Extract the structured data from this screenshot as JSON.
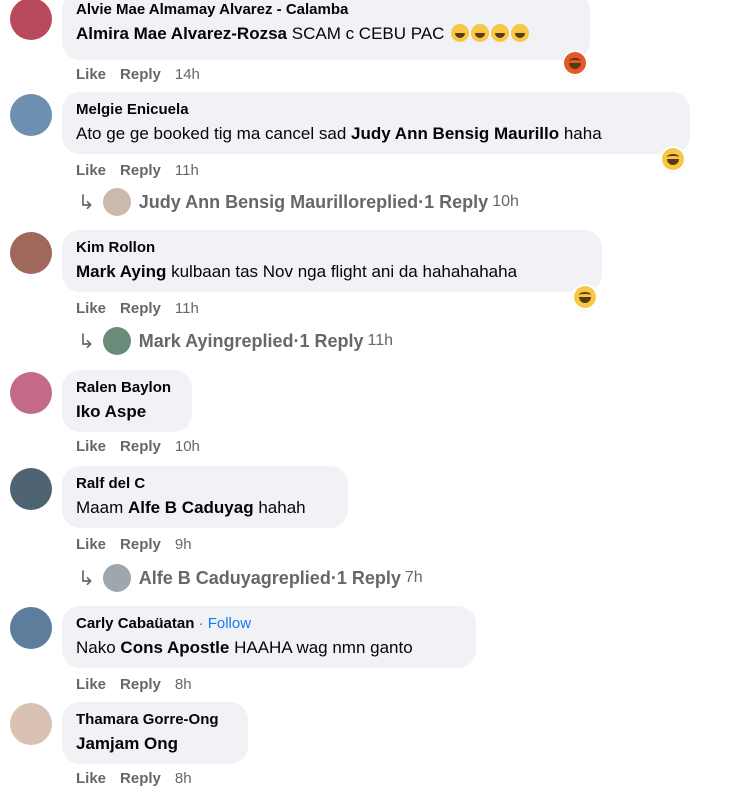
{
  "comments": [
    {
      "author": "Alvie Mae Almamay Alvarez - Calamba",
      "mention": "Almira Mae Alvarez-Rozsa",
      "text": " SCAM c CEBU PAC",
      "like": "Like",
      "reply": "Reply",
      "time": "14h",
      "avatar_color": "#b84a5c"
    },
    {
      "author": "Melgie Enicuela",
      "text_before": "Ato ge ge booked tig ma cancel sad ",
      "mention": "Judy Ann Bensig Maurillo",
      "text_after": " haha",
      "like": "Like",
      "reply": "Reply",
      "time": "11h",
      "avatar_color": "#6d8fb0",
      "replies": {
        "name": "Judy Ann Bensig Maurillo",
        "replied": " replied",
        "dot": " · ",
        "count": "1 Reply",
        "time": "10h"
      }
    },
    {
      "author": "Kim Rollon",
      "mention": "Mark Aying",
      "text": " kulbaan tas Nov nga flight ani da hahahahaha",
      "like": "Like",
      "reply": "Reply",
      "time": "11h",
      "avatar_color": "#a0685a",
      "replies": {
        "name": "Mark Aying",
        "replied": " replied",
        "dot": " · ",
        "count": "1 Reply",
        "time": "11h"
      }
    },
    {
      "author": "Ralen Baylon",
      "mention": "Iko Aspe",
      "like": "Like",
      "reply": "Reply",
      "time": "10h",
      "avatar_color": "#c46a86"
    },
    {
      "author": "Ralf del C",
      "text_before": "Maam ",
      "mention": "Alfe B Caduyag",
      "text_after": " hahah",
      "like": "Like",
      "reply": "Reply",
      "time": "9h",
      "avatar_color": "#4f6472",
      "replies": {
        "name": "Alfe B Caduyag",
        "replied": " replied",
        "dot": " · ",
        "count": "1 Reply",
        "time": "7h"
      }
    },
    {
      "author": "Carly Cabaüatan",
      "dot": " · ",
      "follow": "Follow",
      "text_before": "Nako ",
      "mention": "Cons Apostle",
      "text_after": " HAAHA wag nmn ganto",
      "like": "Like",
      "reply": "Reply",
      "time": "8h",
      "avatar_color": "#5c7d9c"
    },
    {
      "author": "Thamara Gorre-Ong",
      "mention": "Jamjam Ong",
      "like": "Like",
      "reply": "Reply",
      "time": "8h",
      "avatar_color": "#d9c2b3"
    }
  ],
  "colors": {
    "bubble": "#f0f2f5",
    "meta": "#65676b",
    "link": "#1877f2"
  }
}
